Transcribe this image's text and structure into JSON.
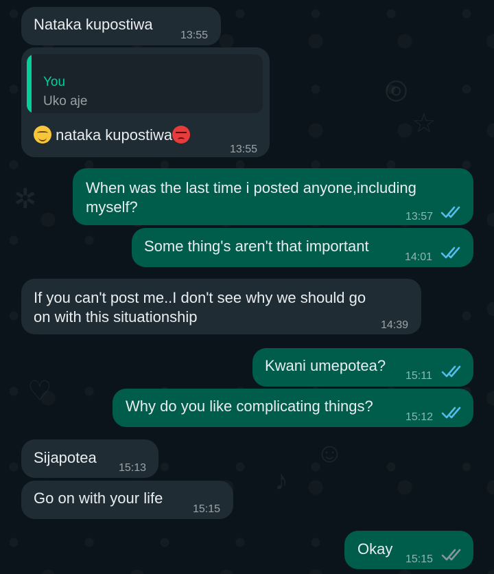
{
  "conversation": {
    "messages": [
      {
        "direction": "incoming",
        "text": "Nataka kupostiwa",
        "time": "13:55"
      },
      {
        "direction": "incoming",
        "quoted": {
          "sender": "You",
          "text": "Uko aje"
        },
        "text": "nataka kupostiwa",
        "leading_emoji": "smiling-face-with-closed-eyes",
        "trailing_emoji": "angry-face",
        "time": "13:55"
      },
      {
        "direction": "outgoing",
        "text_line1": "When was the last time i posted anyone,including",
        "text_line2": "myself?",
        "time": "13:57",
        "status": "read"
      },
      {
        "direction": "outgoing",
        "text": "Some thing's aren't that important",
        "time": "14:01",
        "status": "read"
      },
      {
        "direction": "incoming",
        "text_line1": "If you can't post me..I don't see why we should go",
        "text_line2": "on with this situationship",
        "time": "14:39"
      },
      {
        "direction": "outgoing",
        "text": "Kwani umepotea?",
        "time": "15:11",
        "status": "read"
      },
      {
        "direction": "outgoing",
        "text": "Why do you like complicating things?",
        "time": "15:12",
        "status": "read"
      },
      {
        "direction": "incoming",
        "text": "Sijapotea",
        "time": "15:13"
      },
      {
        "direction": "incoming",
        "text": "Go on with your life",
        "time": "15:15"
      },
      {
        "direction": "outgoing",
        "text": "Okay",
        "time": "15:15",
        "status": "delivered"
      }
    ]
  },
  "colors": {
    "background": "#0b141a",
    "incoming_bubble": "#202c33",
    "outgoing_bubble": "#005c4b",
    "text": "#e9edef",
    "meta": "#8696a0",
    "read_ticks": "#53bdeb",
    "delivered_ticks": "#8696a0",
    "quote_accent": "#06cf9c"
  },
  "icons": {
    "read": "double-check-icon",
    "delivered": "double-check-icon"
  }
}
